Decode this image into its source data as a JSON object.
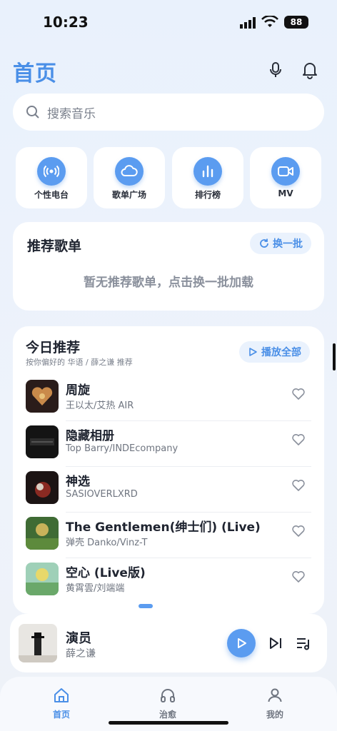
{
  "status_bar": {
    "time": "10:23",
    "battery": "88"
  },
  "header": {
    "title": "首页",
    "mic_icon": "mic-icon",
    "bell_icon": "bell-icon"
  },
  "search": {
    "placeholder": "搜索音乐"
  },
  "quick_tiles": [
    {
      "label": "个性电台",
      "icon": "radio-icon"
    },
    {
      "label": "歌单广场",
      "icon": "cloud-icon"
    },
    {
      "label": "排行榜",
      "icon": "chart-bars-icon"
    },
    {
      "label": "MV",
      "icon": "video-icon"
    }
  ],
  "recommend_playlists": {
    "title": "推荐歌单",
    "refresh_label": "换一批",
    "empty_text": "暂无推荐歌单，点击换一批加载"
  },
  "today": {
    "title": "今日推荐",
    "subtitle": "按你偏好的 华语 / 薛之谦 推荐",
    "play_all_label": "播放全部",
    "songs": [
      {
        "name": "周旋",
        "artist": "王以太/艾热 AIR"
      },
      {
        "name": "隐藏相册",
        "artist": "Top Barry/INDEcompany"
      },
      {
        "name": "神选",
        "artist": "SASIOVERLXRD"
      },
      {
        "name": "The Gentlemen(绅士们) (Live)",
        "artist": "弹壳 Danko/Vinz-T"
      },
      {
        "name": "空心 (Live版)",
        "artist": "黄霄雲/刘端端"
      }
    ]
  },
  "player": {
    "song": "演员",
    "artist": "薛之谦"
  },
  "tabs": [
    {
      "label": "首页",
      "icon": "home-icon",
      "active": true
    },
    {
      "label": "治愈",
      "icon": "headphones-icon",
      "active": false
    },
    {
      "label": "我的",
      "icon": "user-icon",
      "active": false
    }
  ],
  "colors": {
    "accent": "#4a8fe7",
    "accent_fill": "#5b9cf0",
    "background": "#e9f1fc"
  }
}
